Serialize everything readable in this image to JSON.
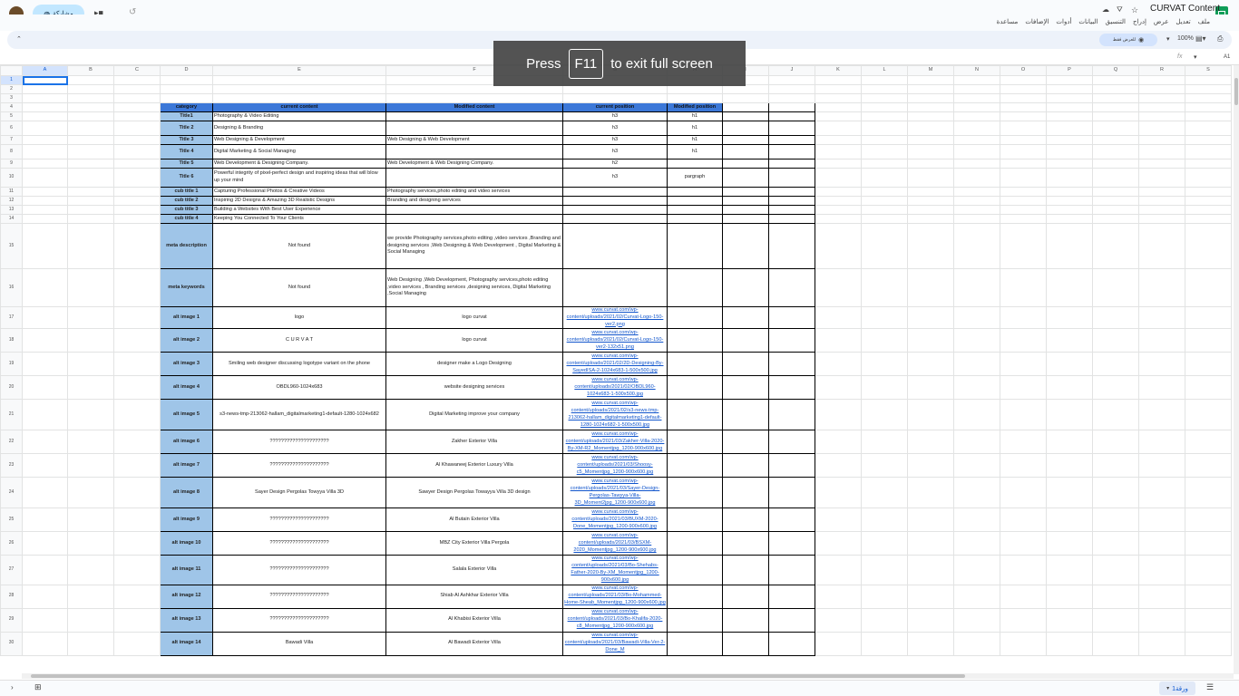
{
  "app": {
    "title": "CURVAT Content",
    "share_label": "مشاركة",
    "menus": [
      "ملف",
      "تعديل",
      "عرض",
      "إدراج",
      "التنسيق",
      "البيانات",
      "أدوات",
      "الإضافات",
      "مساعدة"
    ]
  },
  "toolbar": {
    "zoom": "100%",
    "view_mode": "للعرض فقط"
  },
  "formula": {
    "name_box": "A1"
  },
  "fullscreen": {
    "pre": "Press",
    "key": "F11",
    "post": "to exit full screen"
  },
  "columns": [
    "A",
    "B",
    "C",
    "D",
    "E",
    "F",
    "G",
    "H",
    "I",
    "J",
    "K",
    "L",
    "M",
    "N",
    "O",
    "P",
    "Q",
    "R",
    "S"
  ],
  "header_row": [
    "category",
    "current content",
    "Modified  content",
    "current position",
    "Modified  position"
  ],
  "rows": [
    {
      "n": "5",
      "cat": "Title1",
      "cur": "Photography & Video Editing",
      "mod": "",
      "pos": "h3",
      "mpos": "h1"
    },
    {
      "n": "6",
      "cat": "Title 2",
      "cur": "Designing & Branding",
      "mod": "",
      "pos": "h3",
      "mpos": "h1"
    },
    {
      "n": "7",
      "cat": "Title 3",
      "cur": "Web Designing & Development",
      "mod": "Web Designing & Web  Development",
      "pos": "h3",
      "mpos": "h1"
    },
    {
      "n": "8",
      "cat": "Title 4",
      "cur": "Digital Marketing & Social Managing",
      "mod": "",
      "pos": "h3",
      "mpos": "h1"
    },
    {
      "n": "9",
      "cat": "Title 5",
      "cur": "Web Development & Designing Company.",
      "mod": "Web Development & Web Designing Company.",
      "pos": "h2",
      "mpos": ""
    },
    {
      "n": "10",
      "cat": "Title 6",
      "cur": "Powerful integrity of pixel-perfect design and inspiring ideas that will blow up your mind",
      "mod": "",
      "pos": "h3",
      "mpos": "pargraph"
    },
    {
      "n": "11",
      "cat": "cub title 1",
      "cur": "Capturing Professional Photos & Creative Videos",
      "mod": "Photography services,photo editing and video services",
      "pos": "",
      "mpos": ""
    },
    {
      "n": "12",
      "cat": "cub title 2",
      "cur": "Inspiring 2D Designs & Amazing 3D Realistic Designs",
      "mod": "Branding and designing services",
      "pos": "",
      "mpos": ""
    },
    {
      "n": "13",
      "cat": "cub title 3",
      "cur": "Building a Websites With Best User Experience",
      "mod": "",
      "pos": "",
      "mpos": ""
    },
    {
      "n": "14",
      "cat": "cub title 4",
      "cur": "Keeping You Connected To Your Clients",
      "mod": "",
      "pos": "",
      "mpos": ""
    },
    {
      "n": "15",
      "cat": "meta description",
      "cur": "Not found",
      "mod": "we provide Photography services,photo editing ,video services ,Branding and designing services ,Web Designing & Web  Development , Digital Marketing & Social Managing",
      "pos": "",
      "mpos": ""
    },
    {
      "n": "16",
      "cat": "meta keywords",
      "cur": "Not found",
      "mod": "Web Designing ,Web  Development, Photography services,photo editing ,video services , Branding services ,designing services, Digital Marketing ,Social Managing",
      "pos": "",
      "mpos": ""
    },
    {
      "n": "17",
      "cat": "alt image 1",
      "cur": "logo",
      "mod": "logo curvat",
      "pos": "www.curvat.com/wp-content/uploads/2021/02/Curvat-Logo-150-ver2.png",
      "mpos": ""
    },
    {
      "n": "18",
      "cat": "alt image 2",
      "cur": "C U R V A T",
      "mod": "logo curvat",
      "pos": "www.curvat.com/wp-content/uploads/2021/02/Curvat-Logo-150-ver2-132x51.png",
      "mpos": ""
    },
    {
      "n": "19",
      "cat": "alt image 3",
      "cur": "Smiling web designer discussing logotype variant on the phone",
      "mod": "designer make a Logo Designing",
      "pos": "www.curvat.com/wp-content/uploads/2021/02/2D-Designing-By-SayedISA-2-1024x683-1-500x500.jpg",
      "mpos": ""
    },
    {
      "n": "20",
      "cat": "alt image 4",
      "cur": "OBDL960-1024x683",
      "mod": "website designing services",
      "pos": "www.curvat.com/wp-content/uploads/2021/02/OBDL960-1024x683-1-500x500.jpg",
      "mpos": ""
    },
    {
      "n": "21",
      "cat": "alt image 5",
      "cur": "s3-news-tmp-213062-hallam_digitalmarketing1-default-1280-1024x682",
      "mod": "Digital Marketing improve your company",
      "pos": "www.curvat.com/wp-content/uploads/2021/02/s3-news-tmp-213062-hallam_digitalmarketing1-default-1280-1024x682-1-500x500.jpg",
      "mpos": ""
    },
    {
      "n": "22",
      "cat": "alt image 6",
      "cur": "?????????????????????",
      "mod": "Zakher Exterior Villa",
      "pos": "www.curvat.com/wp-content/uploads/2021/03/Zakher-Villa-2020-By-XM-R2_Momentjpg_1200-900x600.jpg",
      "mpos": ""
    },
    {
      "n": "23",
      "cat": "alt image 7",
      "cur": "?????????????????????",
      "mod": "Al Khawaneej Exterior Luxury Villa",
      "pos": "www.curvat.com/wp-content/uploads/2021/03/Shoosy-c5_Momentjpg_1200-900x600.jpg",
      "mpos": ""
    },
    {
      "n": "24",
      "cat": "alt image 8",
      "cur": "Sayer Design Pergolas Towyya Villa 3D",
      "mod": "Sawyer Design Pergolas Towayya Villa 3D design",
      "pos": "www.curvat.com/wp-content/uploads/2021/03/Sayer-Design-Pergolas-Tawyya-Villa-3D_Moment2jpg_1200-900x600.jpg",
      "mpos": ""
    },
    {
      "n": "25",
      "cat": "alt image 9",
      "cur": "?????????????????????",
      "mod": "Al Butain Exterior Villa",
      "pos": "www.curvat.com/wp-content/uploads/2021/03/BUXM-2020-Done_Momentjpg_1200-900x600.jpg",
      "mpos": ""
    },
    {
      "n": "26",
      "cat": "alt image 10",
      "cur": "?????????????????????",
      "mod": "MBZ City Exterior Villa Pergola",
      "pos": "www.curvat.com/wp-content/uploads/2021/03/BSXM-2020_Momentjpg_1200-900x600.jpg",
      "mpos": ""
    },
    {
      "n": "27",
      "cat": "alt image 11",
      "cur": "?????????????????????",
      "mod": "Salala Exterior Villa",
      "pos": "www.curvat.com/wp-content/uploads/2021/03/Bo-Shehabs-Father-2020-By-XM_Momentjpg_1200-900x600.jpg",
      "mpos": ""
    },
    {
      "n": "28",
      "cat": "alt image 12",
      "cur": "?????????????????????",
      "mod": "Shiab Al Ashkhar Exterior Villa",
      "pos": "www.curvat.com/wp-content/uploads/2021/03/Bo-Mohammed-Home-Sheab_Momentjpg_1200-900x600.jpg",
      "mpos": ""
    },
    {
      "n": "29",
      "cat": "alt image 13",
      "cur": "?????????????????????",
      "mod": "Al Khabisi Exterior Villa",
      "pos": "www.curvat.com/wp-content/uploads/2021/03/Bo-Khalifa-2020-c8_Momentjpg_1200-900x600.jpg",
      "mpos": ""
    },
    {
      "n": "30",
      "cat": "alt image 14",
      "cur": "Bawadi Villa",
      "mod": "Al Bawadi Exterior Villa",
      "pos": "www.curvat.com/wp-content/uploads/2021/03/Bawadi-Villa-Ver-2-Done_M",
      "mpos": ""
    }
  ],
  "sheet_tab": "ورقة1"
}
